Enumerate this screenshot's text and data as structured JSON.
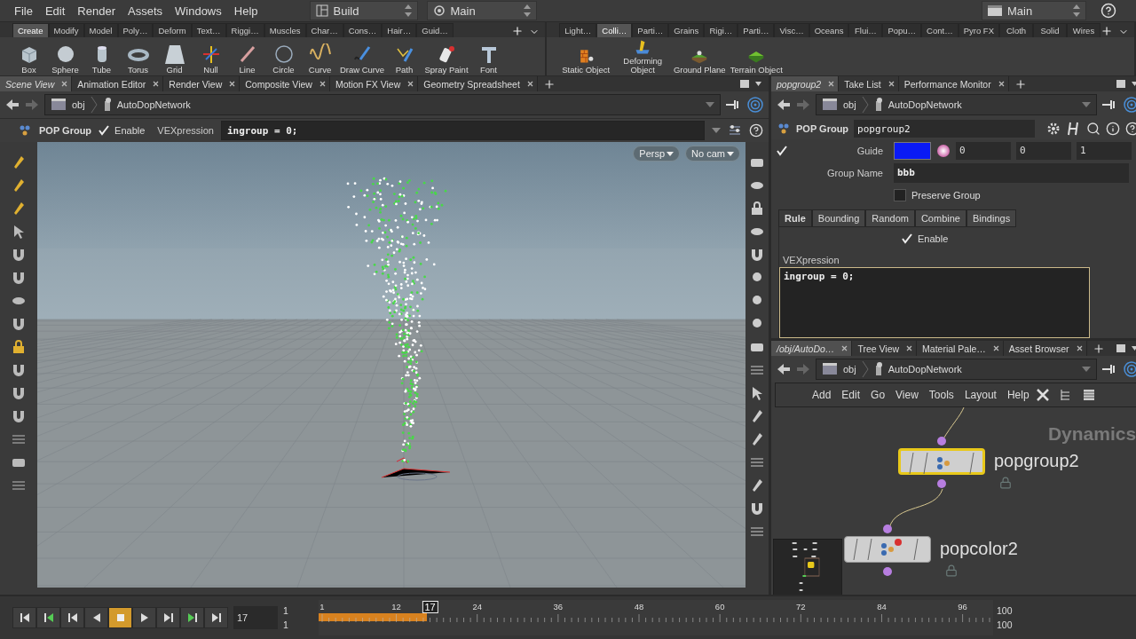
{
  "menu_bar": {
    "items": [
      "File",
      "Edit",
      "Render",
      "Assets",
      "Windows",
      "Help"
    ],
    "desktop": "Build",
    "context": "Main",
    "right_context": "Main"
  },
  "shelf_left": {
    "tabs": [
      {
        "label": "Create",
        "selected": true
      },
      {
        "label": "Modify",
        "selected": false
      },
      {
        "label": "Model",
        "selected": false
      },
      {
        "label": "Poly…",
        "selected": false
      },
      {
        "label": "Deform",
        "selected": false
      },
      {
        "label": "Text…",
        "selected": false
      },
      {
        "label": "Riggi…",
        "selected": false
      },
      {
        "label": "Muscles",
        "selected": false
      },
      {
        "label": "Char…",
        "selected": false
      },
      {
        "label": "Cons…",
        "selected": false
      },
      {
        "label": "Hair…",
        "selected": false
      },
      {
        "label": "Guid…",
        "selected": false
      }
    ],
    "tools": [
      "Box",
      "Sphere",
      "Tube",
      "Torus",
      "Grid",
      "Null",
      "Line",
      "Circle",
      "Curve",
      "Draw Curve",
      "Path",
      "Spray Paint",
      "Font"
    ]
  },
  "shelf_right": {
    "tabs": [
      {
        "label": "Light…",
        "selected": false
      },
      {
        "label": "Colli…",
        "selected": true
      },
      {
        "label": "Parti…",
        "selected": false
      },
      {
        "label": "Grains",
        "selected": false
      },
      {
        "label": "Rigi…",
        "selected": false
      },
      {
        "label": "Parti…",
        "selected": false
      },
      {
        "label": "Visc…",
        "selected": false
      },
      {
        "label": "Oceans",
        "selected": false
      },
      {
        "label": "Flui…",
        "selected": false
      },
      {
        "label": "Popu…",
        "selected": false
      },
      {
        "label": "Cont…",
        "selected": false
      },
      {
        "label": "Pyro FX",
        "selected": false
      },
      {
        "label": "Cloth",
        "selected": false
      },
      {
        "label": "Solid",
        "selected": false
      },
      {
        "label": "Wires",
        "selected": false
      }
    ],
    "tools": [
      "Static Object",
      "Deforming Object",
      "Ground Plane",
      "Terrain Object"
    ]
  },
  "scene_pane": {
    "tabs": [
      {
        "label": "Scene View",
        "selected": true
      },
      {
        "label": "Animation Editor",
        "selected": false
      },
      {
        "label": "Render View",
        "selected": false
      },
      {
        "label": "Composite View",
        "selected": false
      },
      {
        "label": "Motion FX View",
        "selected": false
      },
      {
        "label": "Geometry Spreadsheet",
        "selected": false
      }
    ],
    "path": [
      "obj",
      "AutoDopNetwork"
    ],
    "operator": "POP Group",
    "enable": {
      "label": "Enable",
      "checked": true
    },
    "vex_label": "VEXpression",
    "vex_value": "ingroup = 0;",
    "view_buttons": [
      "Persp",
      "No cam"
    ]
  },
  "param_pane": {
    "tabs": [
      {
        "label": "popgroup2",
        "selected": true
      },
      {
        "label": "Take List",
        "selected": false
      },
      {
        "label": "Performance Monitor",
        "selected": false
      }
    ],
    "path": [
      "obj",
      "AutoDopNetwork"
    ],
    "operator": "POP Group",
    "node_name": "popgroup2",
    "guide": {
      "label": "Guide",
      "checked": true,
      "color": "#0a1af5",
      "values": [
        "0",
        "0",
        "1"
      ]
    },
    "group_name": {
      "label": "Group Name",
      "value": "bbb"
    },
    "preserve_group": {
      "label": "Preserve Group",
      "checked": false
    },
    "subtabs": [
      {
        "label": "Rule",
        "selected": true
      },
      {
        "label": "Bounding",
        "selected": false
      },
      {
        "label": "Random",
        "selected": false
      },
      {
        "label": "Combine",
        "selected": false
      },
      {
        "label": "Bindings",
        "selected": false
      }
    ],
    "enable": {
      "label": "Enable",
      "checked": true
    },
    "vex": {
      "label": "VEXpression",
      "value": "ingroup = 0;"
    }
  },
  "network_pane": {
    "tabs": [
      {
        "label": "/obj/AutoDo…",
        "selected": true
      },
      {
        "label": "Tree View",
        "selected": false
      },
      {
        "label": "Material Pale…",
        "selected": false
      },
      {
        "label": "Asset Browser",
        "selected": false
      }
    ],
    "path": [
      "obj",
      "AutoDopNetwork"
    ],
    "menu": [
      "Add",
      "Edit",
      "Go",
      "View",
      "Tools",
      "Layout",
      "Help"
    ],
    "context_label": "Dynamics",
    "nodes": [
      {
        "name": "popgroup2",
        "selected": true
      },
      {
        "name": "popcolor2",
        "selected": false
      }
    ]
  },
  "timeline": {
    "current_frame": "17",
    "range_start": [
      "1",
      "1"
    ],
    "ticks": [
      "1",
      "12",
      "24",
      "36",
      "48",
      "60",
      "72",
      "84",
      "96"
    ],
    "marker": "17",
    "level": 0.16,
    "range_end": [
      "100",
      "100"
    ]
  }
}
